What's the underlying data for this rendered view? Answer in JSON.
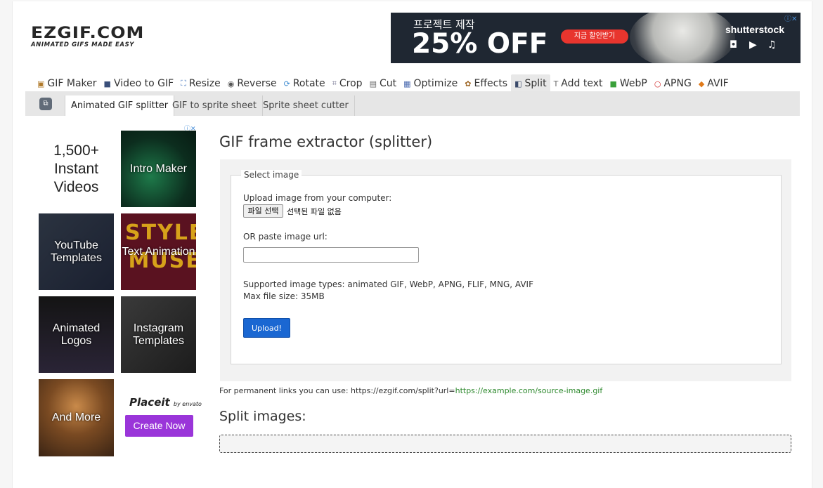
{
  "logo": {
    "main": "EZGIF.COM",
    "tagline": "ANIMATED GIFS MADE EASY"
  },
  "top_ad": {
    "headline": "프로젝트 제작",
    "offer": "25% OFF",
    "button": "지금 할인받기",
    "brand": "shutterstock",
    "adchoices": "ⓘ✕"
  },
  "nav": {
    "items": [
      {
        "icon": "▣",
        "label": "GIF Maker"
      },
      {
        "icon": "■",
        "label": "Video to GIF"
      },
      {
        "icon": "⛶",
        "label": "Resize"
      },
      {
        "icon": "◉",
        "label": "Reverse"
      },
      {
        "icon": "⟳",
        "label": "Rotate"
      },
      {
        "icon": "⌗",
        "label": "Crop"
      },
      {
        "icon": "▤",
        "label": "Cut"
      },
      {
        "icon": "▦",
        "label": "Optimize"
      },
      {
        "icon": "✿",
        "label": "Effects"
      },
      {
        "icon": "◧",
        "label": "Split"
      },
      {
        "icon": "T",
        "label": "Add text"
      },
      {
        "icon": "■",
        "label": "WebP"
      },
      {
        "icon": "○",
        "label": "APNG"
      },
      {
        "icon": "◆",
        "label": "AVIF"
      }
    ],
    "active": "Split"
  },
  "subnav": {
    "tabs": [
      "Animated GIF splitter",
      "GIF to sprite sheet",
      "Sprite sheet cutter"
    ],
    "active": "Animated GIF splitter"
  },
  "side_ad": {
    "adchoices": "ⓘ✕",
    "headline": "1,500+ Instant Videos",
    "tiles": [
      "Intro Maker",
      "YouTube Templates",
      "Text Animation",
      "Animated Logos",
      "Instagram Templates",
      "And More"
    ],
    "art_text": "STYLE MUSE",
    "brand": "Placeit",
    "brand_by": "by envato",
    "cta": "Create Now"
  },
  "main": {
    "title": "GIF frame extractor (splitter)",
    "fieldset_legend": "Select image",
    "upload_label": "Upload image from your computer:",
    "choose_button": "파일 선택",
    "no_file": "선택된 파일 없음",
    "url_label": "OR paste image url:",
    "url_value": "",
    "supported": "Supported image types: animated GIF, WebP, APNG, FLIF, MNG, AVIF",
    "max_size": "Max file size: 35MB",
    "upload_button": "Upload!",
    "perma_prefix": "For permanent links you can use: https://ezgif.com/split?url=",
    "perma_link": "https://example.com/source-image.gif",
    "split_title": "Split images:"
  },
  "colors": {
    "accent": "#1a67d2",
    "ad_button": "#e8352e",
    "cta": "#9a35d9",
    "link": "#2f8a2f"
  }
}
